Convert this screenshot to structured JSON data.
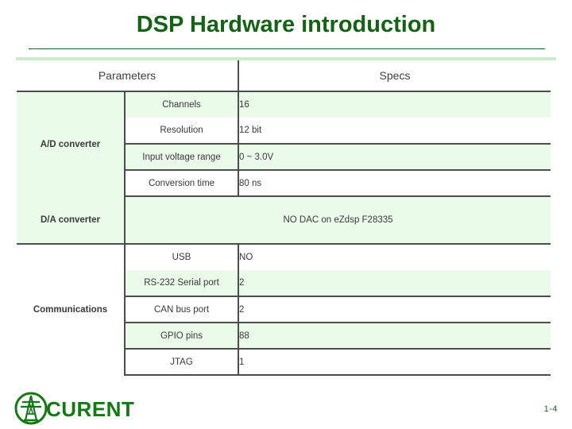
{
  "slide": {
    "title": "DSP Hardware introduction",
    "title_color": "#146314",
    "rule_color": "#1d5c26",
    "tint_color": "#eafbea"
  },
  "table": {
    "headers": {
      "parameters": "Parameters",
      "specs": "Specs"
    },
    "groups": [
      {
        "category": "A/D converter",
        "rows": [
          {
            "parameter": "Channels",
            "spec": "16"
          },
          {
            "parameter": "Resolution",
            "spec": "12 bit"
          },
          {
            "parameter": "Input voltage range",
            "spec": "0 ~ 3.0V"
          },
          {
            "parameter": "Conversion time",
            "spec": "80 ns"
          }
        ]
      },
      {
        "category": "D/A converter",
        "note": "NO DAC on eZdsp F28335",
        "rows": []
      },
      {
        "category": "Communications",
        "rows": [
          {
            "parameter": "USB",
            "spec": "NO"
          },
          {
            "parameter": "RS-232 Serial port",
            "spec": "2"
          },
          {
            "parameter": "CAN bus port",
            "spec": "2"
          },
          {
            "parameter": "GPIO pins",
            "spec": "88"
          },
          {
            "parameter": "JTAG",
            "spec": "1"
          }
        ]
      }
    ]
  },
  "footer": {
    "logo_text": "CURENT",
    "logo_color": "#137a13",
    "page_number": "1-4"
  }
}
